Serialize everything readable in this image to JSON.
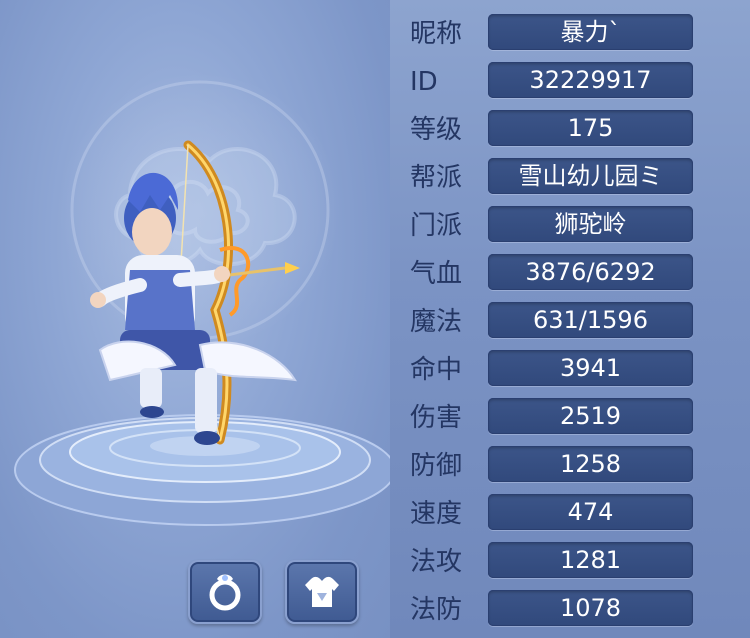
{
  "stats": [
    {
      "label": "昵称",
      "value": "暴力`"
    },
    {
      "label": "ID",
      "value": "32229917"
    },
    {
      "label": "等级",
      "value": "175"
    },
    {
      "label": "帮派",
      "value": "雪山幼儿园ミ"
    },
    {
      "label": "门派",
      "value": "狮驼岭"
    },
    {
      "label": "气血",
      "value": "3876/6292"
    },
    {
      "label": "魔法",
      "value": "631/1596"
    },
    {
      "label": "命中",
      "value": "3941"
    },
    {
      "label": "伤害",
      "value": "2519"
    },
    {
      "label": "防御",
      "value": "1258"
    },
    {
      "label": "速度",
      "value": "474"
    },
    {
      "label": "法攻",
      "value": "1281"
    },
    {
      "label": "法防",
      "value": "1078"
    }
  ],
  "buttons": {
    "ring_icon": "ring-icon",
    "armor_icon": "armor-icon"
  },
  "colors": {
    "label_text": "#243663",
    "value_bg": "#3c5589",
    "value_text": "#ffffff"
  }
}
